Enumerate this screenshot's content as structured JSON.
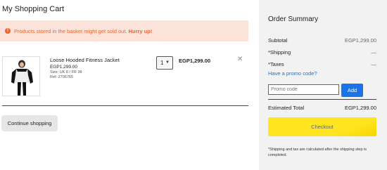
{
  "cart": {
    "title": "My Shopping Cart",
    "alert": {
      "icon": "exclamation-icon",
      "text": "Products stored in the basket might get sold out.",
      "emphasis": "Hurry up!",
      "color": "#e9662c",
      "background": "#fbe3da"
    },
    "items": [
      {
        "name": "Loose Hooded Fitness Jacket",
        "price": "EGP1,299.00",
        "size": "Size: UK 8 / FR 38",
        "ref": "Ref: 2706765",
        "quantity": "1",
        "total": "EGP1,299.00"
      }
    ],
    "continue_label": "Continue shopping"
  },
  "summary": {
    "title": "Order Summary",
    "subtotal_label": "Subtotal",
    "subtotal_value": "EGP1,299.00",
    "shipping_label": "*Shipping",
    "shipping_value": "—",
    "taxes_label": "*Taxes",
    "taxes_value": "—",
    "promo_link": "Have a promo code?",
    "promo_placeholder": "Promo code",
    "promo_button": "Add",
    "estimated_label": "Estimated Total",
    "estimated_value": "EGP1,299.00",
    "checkout_label": "Checkout",
    "note": "*Shipping and tax are calculated after the shipping step is completed.",
    "accent_color": "#1a73e8",
    "checkout_color": "#ffe51f"
  }
}
